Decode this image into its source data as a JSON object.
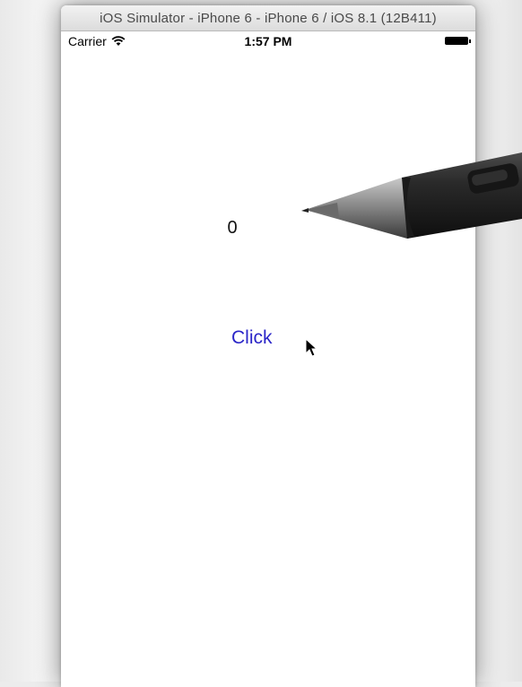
{
  "window": {
    "title": "iOS Simulator - iPhone 6 - iPhone 6 / iOS 8.1 (12B411)"
  },
  "statusbar": {
    "carrier": "Carrier",
    "time": "1:57 PM",
    "wifi_icon": "wifi-icon",
    "battery_icon": "battery-icon",
    "battery_level": 1.0
  },
  "app": {
    "counter_value": "0",
    "button_label": "Click"
  },
  "overlays": {
    "pen": "stylus-pen-image",
    "cursor": "arrow-cursor-icon"
  },
  "colors": {
    "button_tint": "#2b26c8",
    "window_background": "#ffffff"
  }
}
